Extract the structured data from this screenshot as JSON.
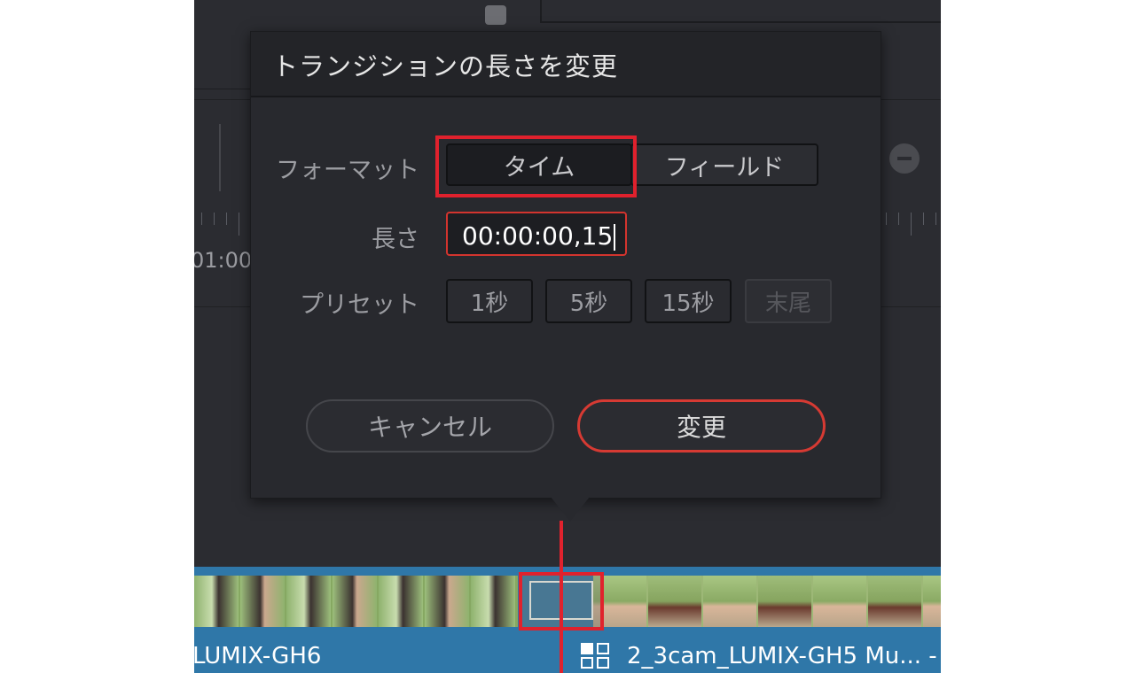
{
  "dialog": {
    "title": "トランジションの長さを変更",
    "format_label": "フォーマット",
    "format_options": [
      "タイム",
      "フィールド"
    ],
    "selected_format": "タイム",
    "duration_label": "長さ",
    "duration_value": "00:00:00,15",
    "preset_label": "プリセット",
    "presets": [
      "1秒",
      "5秒",
      "15秒",
      "末尾"
    ],
    "cancel_label": "キャンセル",
    "change_label": "変更"
  },
  "timeline": {
    "ruler_time": "01:00",
    "clip_left_label": "LUMIX-GH6",
    "clip_right_label": "2_3cam_LUMIX-GH5 Mu... -"
  },
  "colors": {
    "accent_red": "#e0212d",
    "clip_blue": "#2f77a8",
    "panel_bg": "#2b2c31"
  }
}
